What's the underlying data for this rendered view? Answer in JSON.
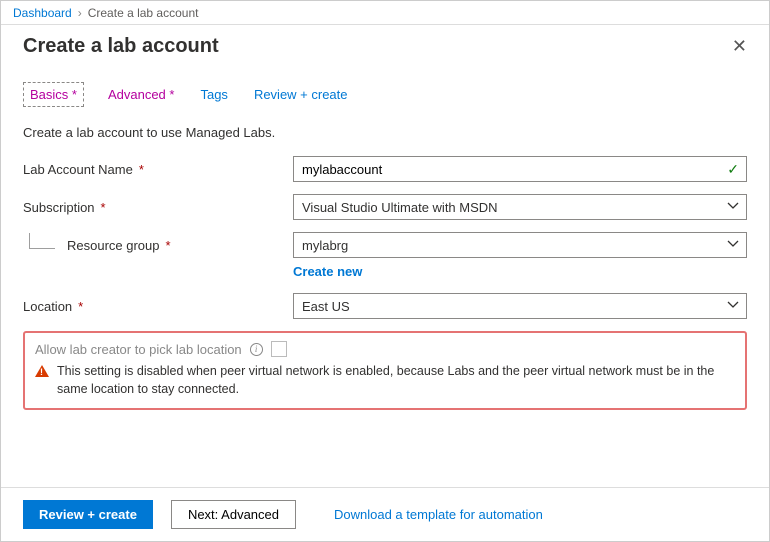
{
  "breadcrumb": {
    "root": "Dashboard",
    "current": "Create a lab account"
  },
  "header": {
    "title": "Create a lab account"
  },
  "tabs": {
    "basics": "Basics",
    "advanced": "Advanced",
    "tagsTab": "Tags",
    "review": "Review + create"
  },
  "desc": "Create a lab account to use Managed Labs.",
  "fields": {
    "labAccountName": {
      "label": "Lab Account Name",
      "value": "mylabaccount"
    },
    "subscription": {
      "label": "Subscription",
      "value": "Visual Studio Ultimate with MSDN"
    },
    "resourceGroup": {
      "label": "Resource group",
      "value": "mylabrg",
      "createNew": "Create new"
    },
    "location": {
      "label": "Location",
      "value": "East US"
    }
  },
  "disabledSection": {
    "label": "Allow lab creator to pick lab location",
    "warning": "This setting is disabled when peer virtual network is enabled, because Labs and the peer virtual network must be in the same location to stay connected."
  },
  "footer": {
    "review": "Review + create",
    "next": "Next: Advanced",
    "download": "Download a template for automation"
  }
}
